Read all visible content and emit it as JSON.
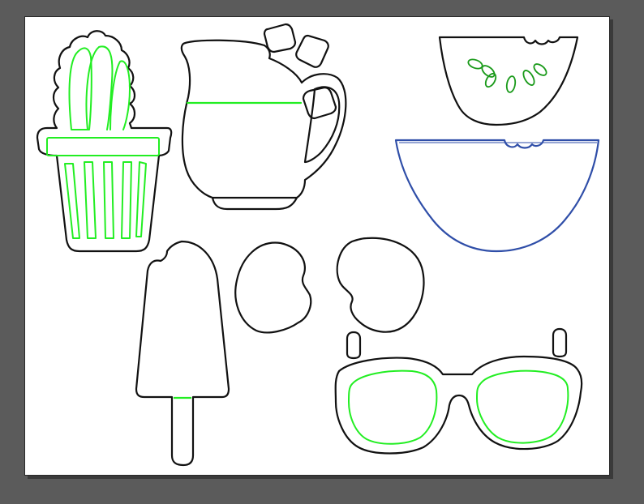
{
  "canvas": {
    "background": "#5b5b5b",
    "artboard_fill": "#ffffff",
    "cut_line_color": "#111111",
    "score_line_color": "#22ee22",
    "score_line_color_dark": "#1a9a1a",
    "watermelon_outline_color": "#2f4ea8"
  },
  "shapes": [
    {
      "name": "cactus-in-pot",
      "icon": "cactus-icon"
    },
    {
      "name": "pitcher-of-lemonade",
      "icon": "pitcher-icon"
    },
    {
      "name": "ice-cube",
      "icon": "ice-cube-icon"
    },
    {
      "name": "watermelon-slice-top",
      "icon": "watermelon-icon"
    },
    {
      "name": "watermelon-slice-bottom",
      "icon": "watermelon-icon"
    },
    {
      "name": "popsicle",
      "icon": "popsicle-icon"
    },
    {
      "name": "kidney-bean-left",
      "icon": "bean-icon"
    },
    {
      "name": "kidney-bean-right",
      "icon": "bean-icon"
    },
    {
      "name": "sunglasses",
      "icon": "sunglasses-icon"
    }
  ]
}
